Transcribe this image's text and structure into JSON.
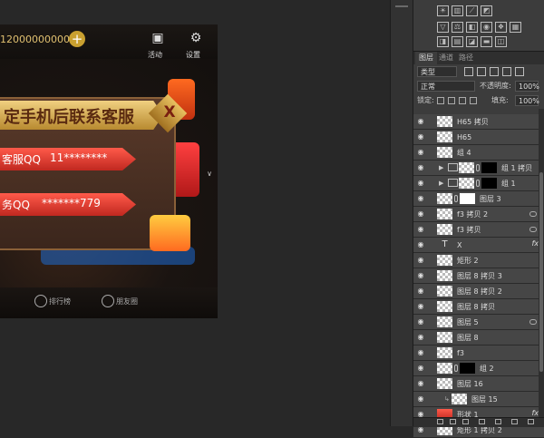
{
  "canvas": {
    "coins": "12000000000",
    "top_icons": [
      {
        "label": "活动",
        "icon": "gift-icon"
      },
      {
        "label": "设置",
        "icon": "gear-icon"
      }
    ],
    "banner_text": "定手机后联系客服",
    "ribbon1_prefix": "客服QQ",
    "ribbon1_value": "11********",
    "ribbon2_prefix": "务QQ",
    "ribbon2_value": "*******779",
    "close_label": "X",
    "nav_items": [
      {
        "label": "排行榜",
        "icon": "trophy-icon"
      },
      {
        "label": "朋友圈",
        "icon": "friends-icon"
      }
    ],
    "side_hint": "∨"
  },
  "adjustments": {
    "rows": [
      [
        "sun-icon",
        "levels-icon",
        "curves-icon",
        "exposure-icon"
      ],
      [
        "vibrance-icon",
        "balance-icon",
        "bw-icon",
        "camera-icon",
        "channel-mixer-icon",
        "lookup-icon"
      ],
      [
        "invert-icon",
        "posterize-icon",
        "threshold-icon",
        "gradient-map-icon",
        "selective-color-icon"
      ]
    ]
  },
  "layers_panel": {
    "tabs": [
      "图层",
      "通道",
      "路径"
    ],
    "active_tab": 0,
    "filter_select": "类型",
    "blend_mode": "正常",
    "opacity_label": "不透明度:",
    "opacity_value": "100%",
    "lock_label": "锁定:",
    "fill_label": "填充:",
    "fill_value": "100%",
    "layers": [
      {
        "name": "H65 拷贝",
        "indent": 0,
        "kind": "pixel"
      },
      {
        "name": "H65",
        "indent": 0,
        "kind": "pixel"
      },
      {
        "name": "组 4",
        "indent": 0,
        "kind": "pixel"
      },
      {
        "name": "组 1 拷贝",
        "indent": 1,
        "kind": "group-mask-black"
      },
      {
        "name": "组 1",
        "indent": 1,
        "kind": "group-mask-black"
      },
      {
        "name": "图层 3",
        "indent": 0,
        "kind": "mask-white"
      },
      {
        "name": "f3 拷贝 2",
        "indent": 0,
        "kind": "smart",
        "link": true
      },
      {
        "name": "f3 拷贝",
        "indent": 0,
        "kind": "smart",
        "link": true
      },
      {
        "name": "X",
        "indent": 0,
        "kind": "text",
        "fx": true
      },
      {
        "name": "矩形 2",
        "indent": 0,
        "kind": "shape"
      },
      {
        "name": "图层 8 拷贝 3",
        "indent": 0,
        "kind": "pixel"
      },
      {
        "name": "图层 8 拷贝 2",
        "indent": 0,
        "kind": "pixel"
      },
      {
        "name": "图层 8 拷贝",
        "indent": 0,
        "kind": "pixel"
      },
      {
        "name": "图层 5",
        "indent": 0,
        "kind": "smart",
        "link": true
      },
      {
        "name": "图层 8",
        "indent": 0,
        "kind": "pixel"
      },
      {
        "name": "f3",
        "indent": 0,
        "kind": "smart"
      },
      {
        "name": "组 2",
        "indent": 0,
        "kind": "mask-black"
      },
      {
        "name": "图层 16",
        "indent": 0,
        "kind": "pixel"
      },
      {
        "name": "图层 15",
        "indent": 1,
        "kind": "clipped"
      },
      {
        "name": "形状 1",
        "indent": 0,
        "kind": "shape-red",
        "fx": true
      },
      {
        "name": "矩形 1 拷贝 2",
        "indent": 0,
        "kind": "shape"
      }
    ]
  }
}
